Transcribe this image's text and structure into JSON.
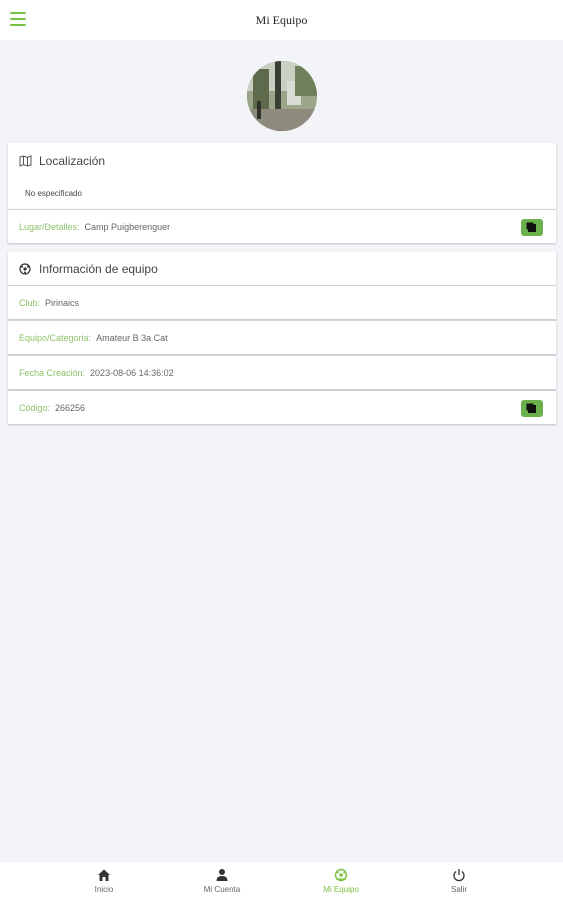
{
  "header": {
    "title": "Mi Equipo"
  },
  "localizacion": {
    "title": "Localización",
    "status": "No especificado",
    "lugar_label": "Lugar/Detalles:",
    "lugar_value": "Camp Puigberenguer"
  },
  "info_equipo": {
    "title": "Información de equipo",
    "club_label": "Club:",
    "club_value": "Pirinaics",
    "equipo_label": "Equipo/Categoria:",
    "equipo_value": "Amateur B 3a Cat",
    "fecha_label": "Fecha Creación:",
    "fecha_value": "2023-08-06 14:36:02",
    "codigo_label": "Código:",
    "codigo_value": "266256"
  },
  "nav": [
    {
      "label": "Inicio",
      "icon": "home-icon"
    },
    {
      "label": "Mi Cuenta",
      "icon": "user-icon"
    },
    {
      "label": "Mi Equipo",
      "icon": "team-icon",
      "active": true
    },
    {
      "label": "Salir",
      "icon": "power-icon"
    }
  ],
  "colors": {
    "accent": "#7cc242",
    "label_green": "#8cc26a",
    "button_green": "#6ab04c",
    "background": "#f2f4f8"
  }
}
